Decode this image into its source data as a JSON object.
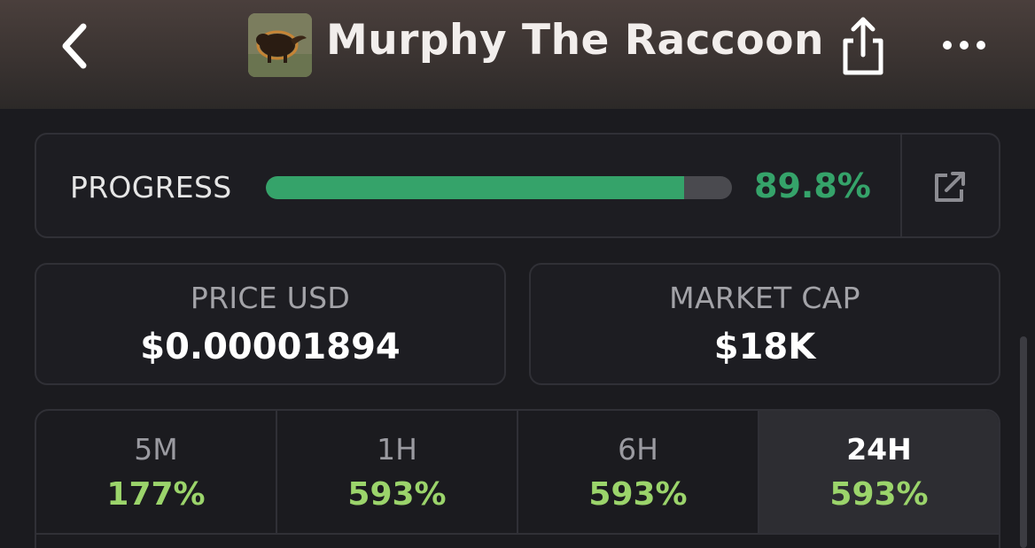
{
  "header": {
    "title": "Murphy The Raccoon",
    "avatar_icon": "raccoon-photo",
    "back_icon": "chevron-left-icon",
    "share_icon": "share-icon",
    "more_icon": "more-horizontal-icon"
  },
  "progress": {
    "label": "PROGRESS",
    "value_text": "89.8%",
    "fraction": 0.898,
    "fill_color": "#35a36a",
    "external_icon": "external-link-icon"
  },
  "stats": {
    "price": {
      "label": "PRICE USD",
      "value": "$0.00001894"
    },
    "market_cap": {
      "label": "MARKET CAP",
      "value": "$18K"
    }
  },
  "timeframes": [
    {
      "label": "5M",
      "change": "177%"
    },
    {
      "label": "1H",
      "change": "593%"
    },
    {
      "label": "6H",
      "change": "593%"
    },
    {
      "label": "24H",
      "change": "593%",
      "selected": true
    }
  ],
  "colors": {
    "accent_green": "#35a36a",
    "change_green": "#9bd46b",
    "background": "#1b1b1f"
  }
}
